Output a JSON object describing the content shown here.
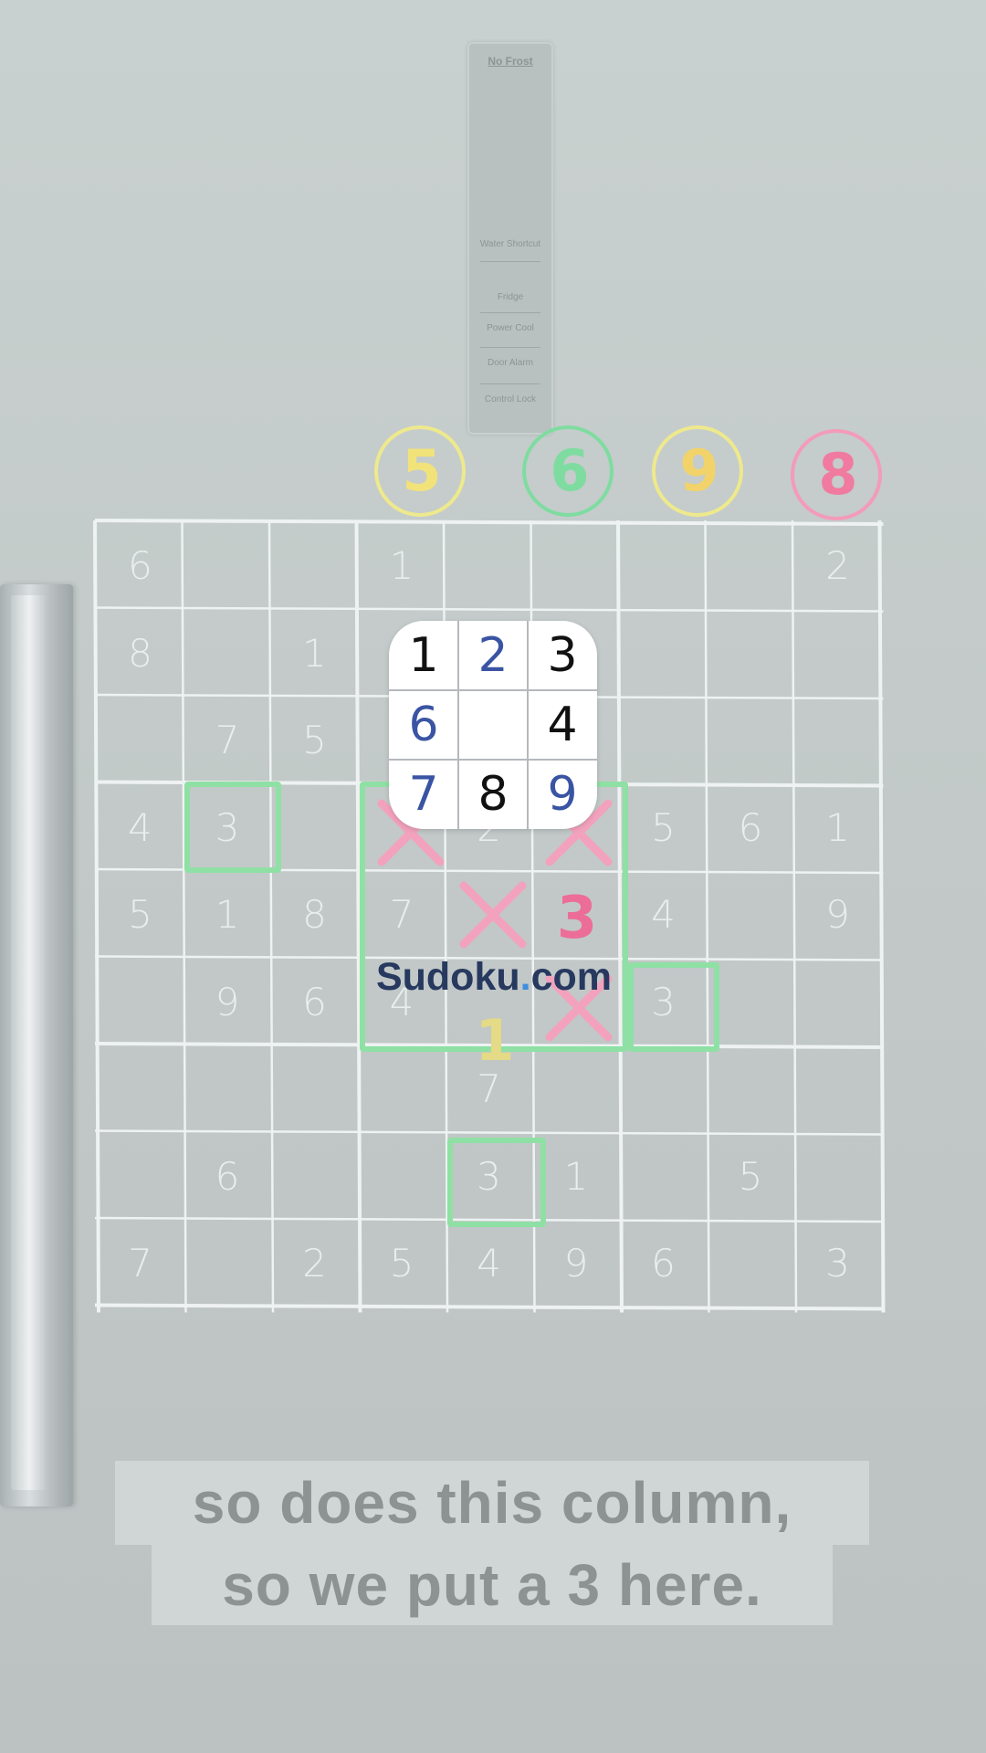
{
  "video": {
    "panel": {
      "title": "No Frost",
      "items": [
        "Water Shortcut",
        "Fridge",
        "Power Cool",
        "Door Alarm",
        "Control Lock"
      ]
    },
    "magnets": [
      {
        "value": "5",
        "color": "#f2e27a",
        "ring": "#eee98c"
      },
      {
        "value": "6",
        "color": "#7fdca0",
        "ring": "#7fdca0"
      },
      {
        "value": "9",
        "color": "#f2d36a",
        "ring": "#eee98c"
      },
      {
        "value": "8",
        "color": "#f07aa0",
        "ring": "#f39bb8"
      }
    ],
    "grid": [
      [
        "6",
        "",
        "",
        "1",
        "",
        "",
        "",
        "",
        "2"
      ],
      [
        "8",
        "",
        "1",
        "",
        "",
        "",
        "",
        "",
        ""
      ],
      [
        "",
        "7",
        "5",
        "",
        "",
        "",
        "",
        "",
        ""
      ],
      [
        "4",
        "3",
        "",
        "",
        "2",
        "",
        "5",
        "6",
        "1"
      ],
      [
        "5",
        "1",
        "8",
        "7",
        "",
        "",
        "4",
        "",
        "9"
      ],
      [
        "",
        "9",
        "6",
        "4",
        "",
        "",
        "3",
        "",
        ""
      ],
      [
        "",
        "",
        "",
        "",
        "7",
        "",
        "",
        "",
        ""
      ],
      [
        "",
        "6",
        "",
        "",
        "3",
        "1",
        "",
        "5",
        ""
      ],
      [
        "7",
        "",
        "2",
        "5",
        "4",
        "9",
        "6",
        "",
        "3"
      ]
    ],
    "highlight_color": "#8fe0a4",
    "cross_color": "#f3a2bd",
    "placed_digit": "3",
    "placed_color": "#ec6d98",
    "candidate_digit": "1",
    "candidate_color": "#e5da86",
    "logo": {
      "digits": [
        "1",
        "2",
        "3",
        "6",
        "",
        "4",
        "7",
        "8",
        "9"
      ],
      "colors": [
        "#111111",
        "#3a54a4",
        "#111111",
        "#3a54a4",
        "#111111",
        "#111111",
        "#3a54a4",
        "#111111",
        "#3a54a4"
      ]
    },
    "brand": {
      "name": "Sudoku",
      "dot": ".",
      "tld": "com"
    },
    "caption": {
      "line1": "so does this column,",
      "line2": "so we put a 3 here."
    }
  }
}
